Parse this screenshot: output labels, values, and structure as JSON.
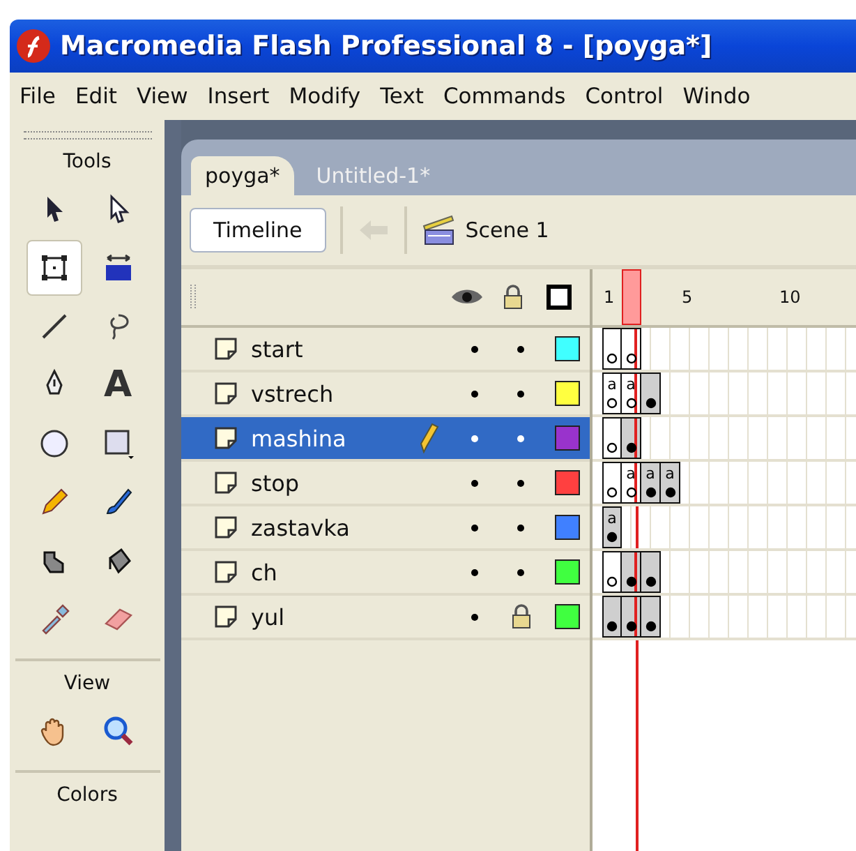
{
  "window": {
    "title": "Macromedia Flash Professional 8 - [poyga*]"
  },
  "menu": [
    "File",
    "Edit",
    "View",
    "Insert",
    "Modify",
    "Text",
    "Commands",
    "Control",
    "Windo"
  ],
  "tools_panel": {
    "title": "Tools",
    "tools": [
      {
        "kind": "arrow",
        "selected": false
      },
      {
        "kind": "subselect",
        "selected": false
      },
      {
        "kind": "free-transform",
        "selected": true
      },
      {
        "kind": "gradient-transform",
        "selected": false
      },
      {
        "kind": "line",
        "selected": false
      },
      {
        "kind": "lasso",
        "selected": false
      },
      {
        "kind": "pen",
        "selected": false
      },
      {
        "kind": "text",
        "glyph": "A",
        "selected": false
      },
      {
        "kind": "oval",
        "selected": false
      },
      {
        "kind": "rectangle",
        "selected": false
      },
      {
        "kind": "pencil",
        "selected": false
      },
      {
        "kind": "brush",
        "selected": false
      },
      {
        "kind": "ink-bottle",
        "selected": false
      },
      {
        "kind": "paint-bucket",
        "selected": false
      },
      {
        "kind": "eyedropper",
        "selected": false
      },
      {
        "kind": "eraser",
        "selected": false
      }
    ],
    "view_title": "View",
    "view_tools": [
      {
        "kind": "hand",
        "selected": false
      },
      {
        "kind": "zoom",
        "selected": false
      }
    ],
    "colors_title": "Colors"
  },
  "document_tabs": [
    {
      "label": "poyga*",
      "selected": true
    },
    {
      "label": "Untitled-1*",
      "selected": false
    }
  ],
  "timeline_toolbar": {
    "timeline_button": "Timeline",
    "back_disabled": true,
    "scene": "Scene 1"
  },
  "ruler": [
    {
      "label": "1",
      "selected": false
    },
    {
      "selected": true
    },
    {
      "selected": false
    },
    {
      "selected": false
    },
    {
      "label": "5",
      "selected": false
    },
    {
      "selected": false
    },
    {
      "selected": false
    },
    {
      "selected": false
    },
    {
      "selected": false
    },
    {
      "label": "10",
      "selected": false
    },
    {
      "selected": false
    },
    {
      "selected": false
    },
    {
      "selected": false
    }
  ],
  "layers": [
    {
      "name": "start",
      "selected": false,
      "visible": true,
      "locked": false,
      "color": "#40ffff",
      "frames": [
        {
          "kind": "blank-key"
        },
        {
          "kind": "blank-key"
        }
      ]
    },
    {
      "name": "vstrech",
      "selected": false,
      "visible": true,
      "locked": false,
      "color": "#ffff40",
      "frames": [
        {
          "kind": "blank-key",
          "label": "a"
        },
        {
          "kind": "blank-key",
          "label": "a"
        },
        {
          "kind": "key"
        }
      ]
    },
    {
      "name": "mashina",
      "selected": true,
      "visible": true,
      "locked": false,
      "color": "#9933cc",
      "frames": [
        {
          "kind": "blank-key"
        },
        {
          "kind": "key"
        }
      ]
    },
    {
      "name": "stop",
      "selected": false,
      "visible": true,
      "locked": false,
      "color": "#ff4040",
      "frames": [
        {
          "kind": "blank-key"
        },
        {
          "kind": "blank-key",
          "label": "a"
        },
        {
          "kind": "key",
          "label": "a"
        },
        {
          "kind": "key",
          "label": "a"
        }
      ]
    },
    {
      "name": "zastavka",
      "selected": false,
      "visible": true,
      "locked": false,
      "color": "#4080ff",
      "frames": [
        {
          "kind": "key",
          "label": "a"
        }
      ]
    },
    {
      "name": "ch",
      "selected": false,
      "visible": true,
      "locked": false,
      "color": "#40ff40",
      "frames": [
        {
          "kind": "blank-key"
        },
        {
          "kind": "key"
        },
        {
          "kind": "key"
        }
      ]
    },
    {
      "name": "yul",
      "selected": false,
      "visible": true,
      "locked": true,
      "color": "#40ff40",
      "frames": [
        {
          "kind": "key"
        },
        {
          "kind": "key"
        },
        {
          "kind": "key"
        }
      ]
    }
  ]
}
